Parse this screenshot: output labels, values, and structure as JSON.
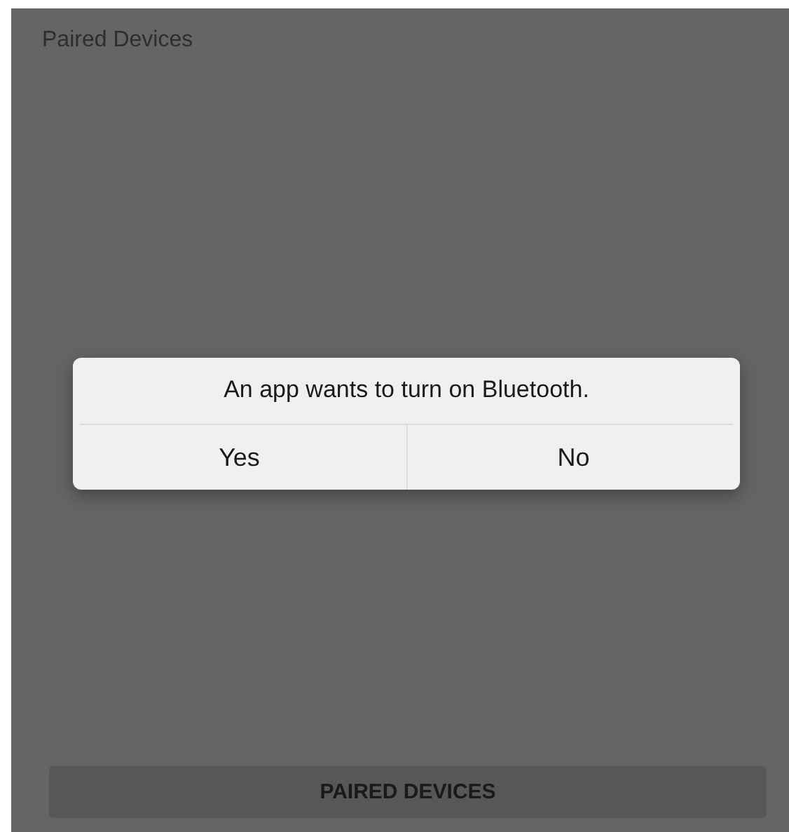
{
  "screen": {
    "title": "Paired Devices"
  },
  "bottom_button": {
    "label": "PAIRED DEVICES"
  },
  "dialog": {
    "message": "An app wants to turn on Bluetooth.",
    "buttons": [
      {
        "label": "Yes"
      },
      {
        "label": "No"
      }
    ]
  }
}
